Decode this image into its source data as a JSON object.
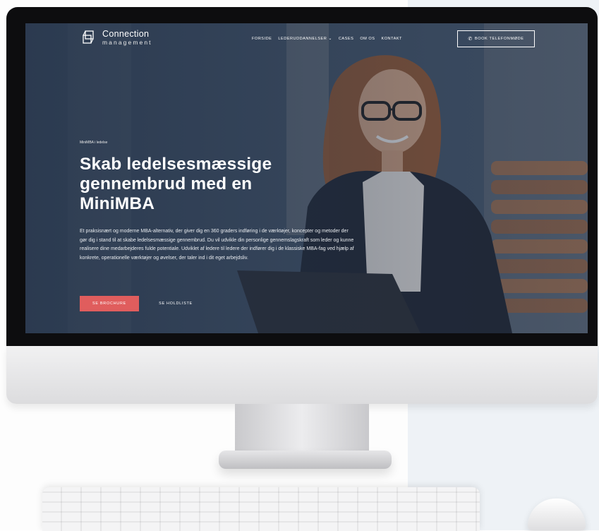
{
  "brand": {
    "name_line1": "Connection",
    "name_line2": "management"
  },
  "nav": {
    "items": [
      {
        "label": "FORSIDE"
      },
      {
        "label": "LEDERUDDANNELSER"
      },
      {
        "label": "CASES"
      },
      {
        "label": "OM OS"
      },
      {
        "label": "KONTAKT"
      }
    ],
    "book_label": "BOOK TELEFONMØDE"
  },
  "hero": {
    "eyebrow": "MiniMBA i ledelse",
    "title": "Skab ledelsesmæssige gennembrud med en MiniMBA",
    "body": "Et praksisnært og moderne MBA-alternativ, der giver dig en 360 graders indføring i de værktøjer, koncepter og metoder der gør dig i stand til at skabe ledelsesmæssige gennembrud. Du vil udvikle din personlige gennemslagskraft som leder og kunne realisere dine medarbejderes fulde potentiale. Udviklet af ledere til ledere der indfører dig i de klassiske MBA-fag ved hjælp af konkrete, operationelle værktøjer og øvelser, der taler ind i dit eget arbejdsliv.",
    "primary_button": "SE BROCHURE",
    "secondary_button": "SE HOLDLISTE"
  },
  "colors": {
    "accent": "#e05d5d",
    "overlay": "#223046",
    "backdrop_right": "#eef2f6"
  },
  "icons": {
    "logo": "cube-outline-icon",
    "phone": "phone-icon",
    "dropdown": "chevron-down-icon"
  }
}
